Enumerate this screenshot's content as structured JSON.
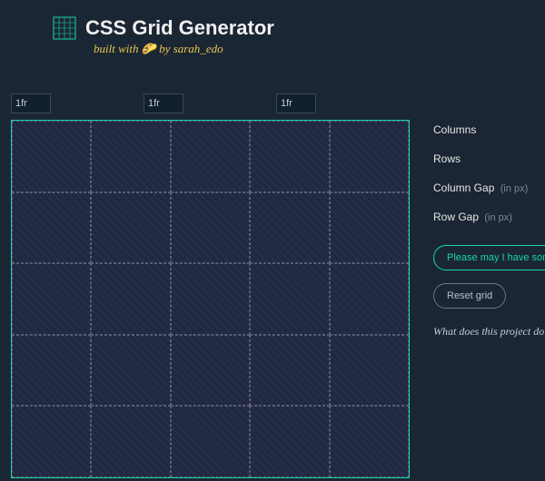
{
  "header": {
    "title": "CSS Grid Generator",
    "subtitle_prefix": "built with ",
    "subtitle_emoji": "🌮",
    "subtitle_suffix": " by sarah_edo"
  },
  "column_tracks": [
    "1fr",
    "1fr",
    "1fr"
  ],
  "controls": {
    "columns_label": "Columns",
    "columns_value": "5",
    "rows_label": "Rows",
    "rows_value": "5",
    "colgap_label": "Column Gap",
    "colgap_hint": "(in px)",
    "colgap_value": "0",
    "rowgap_label": "Row Gap",
    "rowgap_hint": "(in px)",
    "rowgap_value": "0"
  },
  "buttons": {
    "code": "Please may I have some code",
    "reset": "Reset grid"
  },
  "help": "What does this project do?",
  "colors": {
    "accent": "#16d5a6"
  }
}
